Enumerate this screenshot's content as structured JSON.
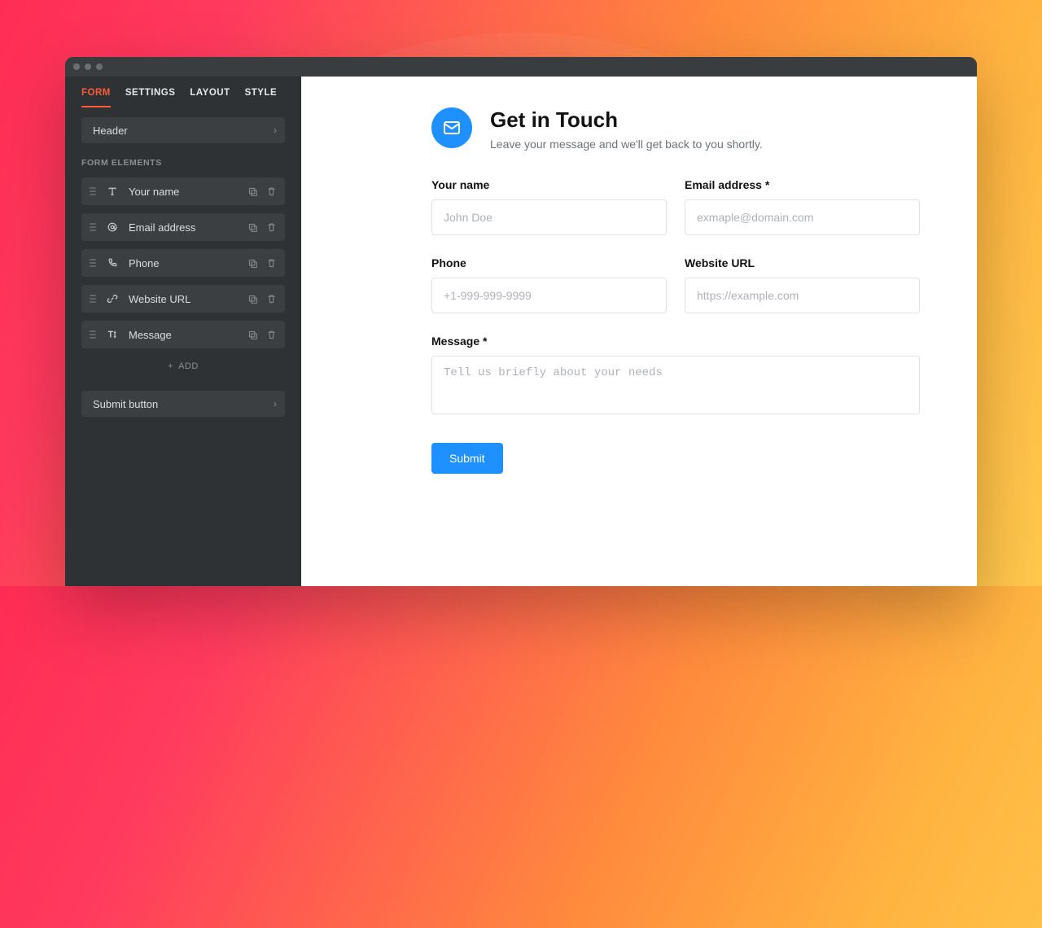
{
  "sidebar": {
    "tabs": [
      "FORM",
      "SETTINGS",
      "LAYOUT",
      "STYLE"
    ],
    "active_tab": 0,
    "header_row": "Header",
    "section_label": "FORM ELEMENTS",
    "elements": [
      {
        "icon": "text-icon",
        "label": "Your name"
      },
      {
        "icon": "at-icon",
        "label": "Email address"
      },
      {
        "icon": "phone-icon",
        "label": "Phone"
      },
      {
        "icon": "link-icon",
        "label": "Website URL"
      },
      {
        "icon": "text-height-icon",
        "label": "Message"
      }
    ],
    "add_label": "ADD",
    "footer_row": "Submit button"
  },
  "form": {
    "title": "Get in Touch",
    "subtitle": "Leave your message and we'll get back to you shortly.",
    "fields": {
      "name": {
        "label": "Your name",
        "placeholder": "John Doe"
      },
      "email": {
        "label": "Email address *",
        "placeholder": "exmaple@domain.com"
      },
      "phone": {
        "label": "Phone",
        "placeholder": "+1-999-999-9999"
      },
      "website": {
        "label": "Website URL",
        "placeholder": "https://example.com"
      },
      "message": {
        "label": "Message *",
        "placeholder": "Tell us briefly about your needs"
      }
    },
    "submit_label": "Submit"
  },
  "colors": {
    "accent": "#1e90ff",
    "tab_active": "#ff5b3a"
  }
}
